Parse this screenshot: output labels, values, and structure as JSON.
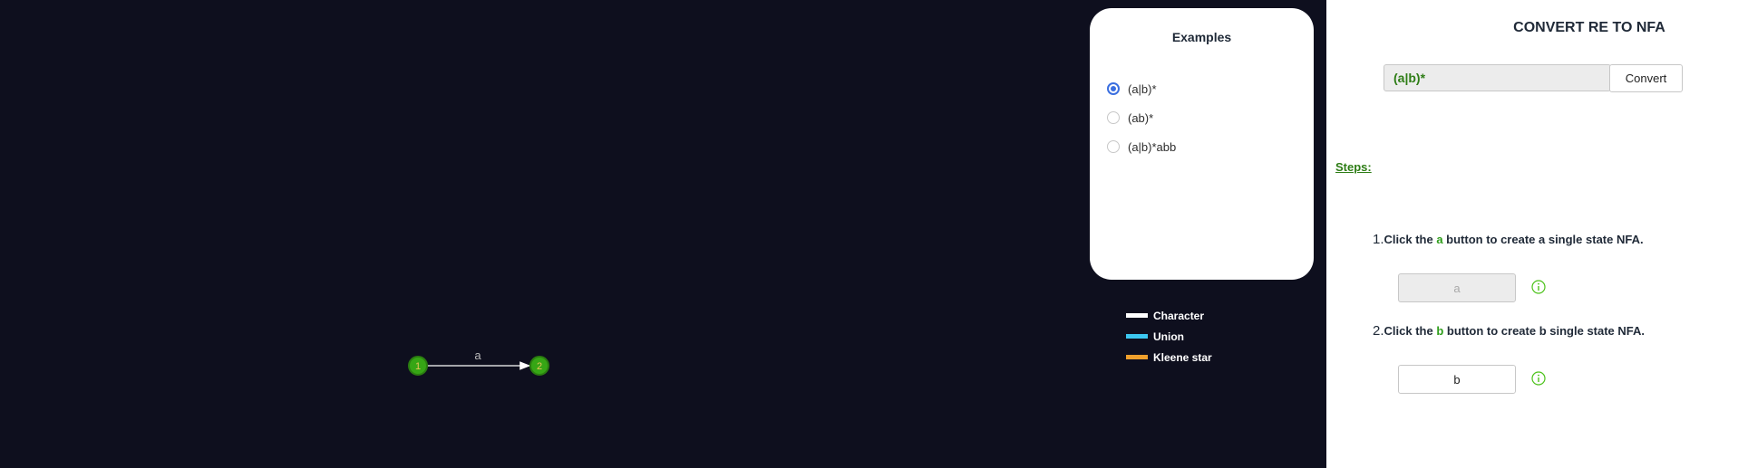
{
  "graph": {
    "states": [
      {
        "id": "1",
        "label": "1"
      },
      {
        "id": "2",
        "label": "2"
      }
    ],
    "transitions": [
      {
        "from": "1",
        "to": "2",
        "label": "a"
      }
    ],
    "state_color": "#36a615",
    "edge_color": "#ffffff"
  },
  "examples": {
    "title": "Examples",
    "options": [
      {
        "label": "(a|b)*",
        "selected": true
      },
      {
        "label": "(ab)*",
        "selected": false
      },
      {
        "label": "(a|b)*abb",
        "selected": false
      }
    ]
  },
  "legend": {
    "items": [
      {
        "label": "Character",
        "color": "#ffffff"
      },
      {
        "label": "Union",
        "color": "#3cc7f0"
      },
      {
        "label": "Kleene star",
        "color": "#f0a02c"
      }
    ]
  },
  "panel": {
    "title": "CONVERT RE TO NFA",
    "regex_value": "(a|b)*",
    "convert_label": "Convert",
    "steps_heading": "Steps:",
    "steps": [
      {
        "number": "1.",
        "text_before": "Click the ",
        "highlight": "a",
        "text_after": " button to create a single state NFA.",
        "button_label": "a",
        "button_enabled": false
      },
      {
        "number": "2.",
        "text_before": "Click the ",
        "highlight": "b",
        "text_after": " button to create b single state NFA.",
        "button_label": "b",
        "button_enabled": true
      }
    ]
  },
  "colors": {
    "canvas_bg": "#0e0f1e",
    "accent_green": "#2e9d1a",
    "radio_blue": "#3b6fe0"
  }
}
